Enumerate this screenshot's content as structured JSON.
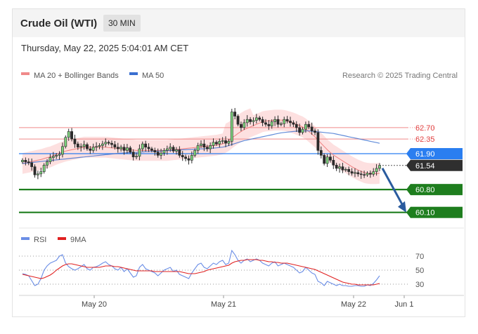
{
  "header": {
    "instrument": "Crude Oil (WTI)",
    "timeframe": "30 MIN"
  },
  "datetime": "Thursday, May 22, 2025 5:04:01 AM CET",
  "legend": {
    "ma20": "MA 20 + Bollinger Bands",
    "ma50": "MA 50",
    "rsi": "RSI",
    "rsi_ma": "9MA"
  },
  "credit": "Research © 2025 Trading Central",
  "colors": {
    "resistance": "#f08a8a",
    "support": "#1e7e1e",
    "current": "#2f2f2f",
    "pivot": "#2a7ef0",
    "ma50": "#3a6fd0",
    "bands": "#fcd6d6",
    "rsi": "#6b8ee6",
    "rsi_ma": "#e02020",
    "arrow": "#2a5b9e"
  },
  "chart_data": [
    {
      "type": "candlestick",
      "x_ticks": [
        "May 20",
        "May 21",
        "May 22",
        "Jun 1"
      ],
      "y_range": [
        59.9,
        63.6
      ],
      "levels": [
        {
          "label": "62.70",
          "value": 62.7,
          "kind": "resistance"
        },
        {
          "label": "62.35",
          "value": 62.35,
          "kind": "resistance"
        },
        {
          "label": "61.90",
          "value": 61.9,
          "kind": "pivot"
        },
        {
          "label": "61.54",
          "value": 61.54,
          "kind": "current"
        },
        {
          "label": "60.80",
          "value": 60.8,
          "kind": "support"
        },
        {
          "label": "60.10",
          "value": 60.1,
          "kind": "support"
        }
      ],
      "close": [
        61.7,
        61.65,
        61.62,
        61.5,
        61.25,
        61.28,
        61.35,
        61.55,
        61.65,
        61.78,
        61.82,
        61.85,
        61.88,
        62.12,
        62.4,
        62.58,
        62.35,
        62.2,
        62.1,
        62.12,
        62.18,
        62.05,
        62.0,
        62.1,
        62.12,
        62.15,
        62.2,
        62.25,
        62.22,
        62.18,
        62.1,
        62.05,
        62.1,
        62.0,
        62.08,
        61.95,
        61.8,
        61.82,
        62.05,
        62.2,
        62.1,
        62.05,
        62.0,
        61.95,
        61.85,
        61.92,
        62.0,
        62.05,
        62.1,
        61.98,
        62.02,
        61.85,
        61.8,
        61.75,
        61.7,
        61.85,
        62.0,
        62.15,
        62.2,
        62.1,
        62.05,
        62.15,
        62.25,
        62.2,
        62.28,
        62.3,
        62.22,
        62.28,
        63.18,
        63.05,
        62.8,
        62.7,
        62.85,
        62.95,
        62.88,
        62.92,
        63.0,
        62.95,
        62.85,
        62.8,
        62.75,
        62.88,
        62.95,
        62.8,
        62.82,
        62.95,
        62.9,
        62.85,
        62.8,
        62.7,
        62.55,
        62.65,
        62.8,
        62.72,
        62.6,
        62.55,
        62.0,
        61.85,
        61.6,
        61.8,
        61.7,
        61.55,
        61.45,
        61.5,
        61.4,
        61.42,
        61.35,
        61.3,
        61.32,
        61.28,
        61.26,
        61.25,
        61.3,
        61.27,
        61.35,
        61.45,
        61.54
      ],
      "ma20": [
        61.6,
        61.62,
        61.64,
        61.66,
        61.68,
        61.7,
        61.72,
        61.75,
        61.78,
        61.8,
        61.84,
        61.88,
        61.92,
        61.95,
        61.98,
        62.0,
        62.02,
        62.04,
        62.06,
        62.08,
        62.1,
        62.1,
        62.1,
        62.1,
        62.1,
        62.1,
        62.1,
        62.1,
        62.09,
        62.08,
        62.07,
        62.06,
        62.05,
        62.04,
        62.03,
        62.02,
        62.01,
        62.0,
        62.0,
        62.0,
        62.0,
        62.0,
        62.0,
        62.0,
        62.0,
        62.0,
        62.0,
        62.0,
        62.01,
        62.02,
        62.03,
        62.04,
        62.05,
        62.06,
        62.07,
        62.08,
        62.09,
        62.1,
        62.11,
        62.12,
        62.13,
        62.14,
        62.15,
        62.16,
        62.18,
        62.2,
        62.25,
        62.3,
        62.38,
        62.45,
        62.52,
        62.58,
        62.64,
        62.68,
        62.72,
        62.76,
        62.8,
        62.84,
        62.88,
        62.9,
        62.91,
        62.92,
        62.93,
        62.93,
        62.93,
        62.92,
        62.9,
        62.87,
        62.84,
        62.8,
        62.76,
        62.72,
        62.66,
        62.58,
        62.5,
        62.42,
        62.32,
        62.22,
        62.12,
        62.02,
        61.94,
        61.86,
        61.8,
        61.74,
        61.68,
        61.62,
        61.56,
        61.5,
        61.45,
        61.4,
        61.36,
        61.32,
        61.3,
        61.29,
        61.29,
        61.29,
        61.3
      ],
      "ma50": [
        61.6,
        61.61,
        61.62,
        61.63,
        61.64,
        61.65,
        61.66,
        61.67,
        61.68,
        61.69,
        61.7,
        61.71,
        61.72,
        61.73,
        61.74,
        61.75,
        61.76,
        61.77,
        61.78,
        61.79,
        61.8,
        61.81,
        61.82,
        61.83,
        61.84,
        61.85,
        61.86,
        61.87,
        61.88,
        61.89,
        61.9,
        61.91,
        61.92,
        61.92,
        61.93,
        61.93,
        61.94,
        61.94,
        61.95,
        61.95,
        61.96,
        61.96,
        61.97,
        61.97,
        61.98,
        61.98,
        61.99,
        61.99,
        62.0,
        62.0,
        62.01,
        62.01,
        62.02,
        62.02,
        62.03,
        62.03,
        62.04,
        62.04,
        62.05,
        62.05,
        62.06,
        62.06,
        62.07,
        62.08,
        62.09,
        62.1,
        62.12,
        62.15,
        62.18,
        62.21,
        62.24,
        62.27,
        62.3,
        62.32,
        62.34,
        62.36,
        62.38,
        62.4,
        62.42,
        62.44,
        62.46,
        62.48,
        62.5,
        62.52,
        62.54,
        62.55,
        62.56,
        62.57,
        62.58,
        62.59,
        62.6,
        62.6,
        62.6,
        62.6,
        62.59,
        62.58,
        62.57,
        62.56,
        62.55,
        62.54,
        62.53,
        62.52,
        62.5,
        62.48,
        62.46,
        62.44,
        62.42,
        62.4,
        62.38,
        62.36,
        62.34,
        62.32,
        62.3,
        62.28,
        62.26,
        62.24,
        62.22
      ],
      "bollinger_width": 0.32,
      "projection": {
        "from": 61.54,
        "to": 60.1
      }
    },
    {
      "type": "line",
      "title": "RSI",
      "levels": [
        70,
        50,
        30
      ],
      "y_range": [
        15,
        85
      ],
      "series": [
        {
          "name": "RSI",
          "values": [
            45,
            44,
            42,
            35,
            28,
            30,
            38,
            50,
            56,
            60,
            62,
            64,
            70,
            72,
            60,
            55,
            52,
            50,
            52,
            55,
            58,
            52,
            50,
            54,
            55,
            57,
            60,
            62,
            58,
            56,
            52,
            50,
            54,
            48,
            52,
            46,
            40,
            42,
            54,
            58,
            52,
            50,
            48,
            46,
            42,
            46,
            50,
            52,
            54,
            48,
            50,
            44,
            42,
            40,
            38,
            46,
            52,
            58,
            60,
            54,
            52,
            56,
            60,
            58,
            62,
            64,
            58,
            60,
            78,
            72,
            64,
            60,
            64,
            66,
            62,
            64,
            66,
            64,
            60,
            58,
            56,
            60,
            62,
            56,
            58,
            60,
            58,
            56,
            54,
            50,
            46,
            48,
            54,
            50,
            46,
            44,
            34,
            32,
            28,
            34,
            32,
            30,
            28,
            30,
            28,
            28,
            27,
            27,
            28,
            28,
            27,
            27,
            29,
            28,
            31,
            36,
            42
          ]
        },
        {
          "name": "9MA",
          "values": [
            44,
            43,
            42,
            41,
            40,
            39,
            38,
            39,
            41,
            43,
            46,
            50,
            53,
            56,
            58,
            59,
            59,
            58,
            57,
            56,
            55,
            54,
            54,
            54,
            54,
            54,
            55,
            56,
            56,
            56,
            55,
            55,
            54,
            53,
            52,
            51,
            50,
            49,
            49,
            49,
            49,
            49,
            49,
            48,
            48,
            48,
            48,
            48,
            48,
            48,
            48,
            48,
            47,
            46,
            45,
            45,
            45,
            46,
            47,
            48,
            50,
            51,
            52,
            53,
            54,
            55,
            56,
            57,
            60,
            62,
            63,
            64,
            64,
            65,
            65,
            65,
            65,
            64,
            64,
            63,
            62,
            62,
            61,
            61,
            60,
            60,
            60,
            59,
            58,
            57,
            56,
            55,
            54,
            53,
            52,
            51,
            49,
            47,
            45,
            43,
            41,
            39,
            37,
            35,
            33,
            32,
            31,
            30,
            30,
            29,
            29,
            29,
            29,
            29,
            29,
            30,
            31
          ]
        }
      ]
    }
  ]
}
